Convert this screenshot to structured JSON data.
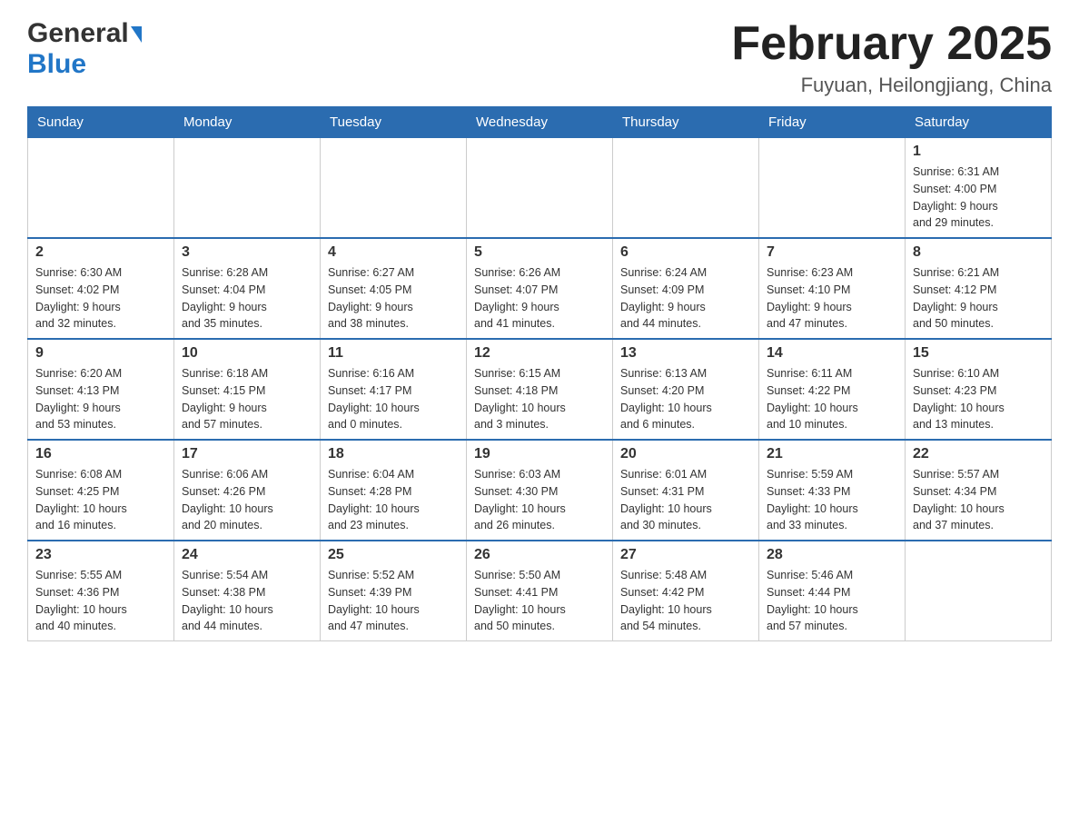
{
  "header": {
    "logo_general": "General",
    "logo_blue": "Blue",
    "month_title": "February 2025",
    "location": "Fuyuan, Heilongjiang, China"
  },
  "weekdays": [
    "Sunday",
    "Monday",
    "Tuesday",
    "Wednesday",
    "Thursday",
    "Friday",
    "Saturday"
  ],
  "weeks": [
    [
      {
        "day": "",
        "info": ""
      },
      {
        "day": "",
        "info": ""
      },
      {
        "day": "",
        "info": ""
      },
      {
        "day": "",
        "info": ""
      },
      {
        "day": "",
        "info": ""
      },
      {
        "day": "",
        "info": ""
      },
      {
        "day": "1",
        "info": "Sunrise: 6:31 AM\nSunset: 4:00 PM\nDaylight: 9 hours\nand 29 minutes."
      }
    ],
    [
      {
        "day": "2",
        "info": "Sunrise: 6:30 AM\nSunset: 4:02 PM\nDaylight: 9 hours\nand 32 minutes."
      },
      {
        "day": "3",
        "info": "Sunrise: 6:28 AM\nSunset: 4:04 PM\nDaylight: 9 hours\nand 35 minutes."
      },
      {
        "day": "4",
        "info": "Sunrise: 6:27 AM\nSunset: 4:05 PM\nDaylight: 9 hours\nand 38 minutes."
      },
      {
        "day": "5",
        "info": "Sunrise: 6:26 AM\nSunset: 4:07 PM\nDaylight: 9 hours\nand 41 minutes."
      },
      {
        "day": "6",
        "info": "Sunrise: 6:24 AM\nSunset: 4:09 PM\nDaylight: 9 hours\nand 44 minutes."
      },
      {
        "day": "7",
        "info": "Sunrise: 6:23 AM\nSunset: 4:10 PM\nDaylight: 9 hours\nand 47 minutes."
      },
      {
        "day": "8",
        "info": "Sunrise: 6:21 AM\nSunset: 4:12 PM\nDaylight: 9 hours\nand 50 minutes."
      }
    ],
    [
      {
        "day": "9",
        "info": "Sunrise: 6:20 AM\nSunset: 4:13 PM\nDaylight: 9 hours\nand 53 minutes."
      },
      {
        "day": "10",
        "info": "Sunrise: 6:18 AM\nSunset: 4:15 PM\nDaylight: 9 hours\nand 57 minutes."
      },
      {
        "day": "11",
        "info": "Sunrise: 6:16 AM\nSunset: 4:17 PM\nDaylight: 10 hours\nand 0 minutes."
      },
      {
        "day": "12",
        "info": "Sunrise: 6:15 AM\nSunset: 4:18 PM\nDaylight: 10 hours\nand 3 minutes."
      },
      {
        "day": "13",
        "info": "Sunrise: 6:13 AM\nSunset: 4:20 PM\nDaylight: 10 hours\nand 6 minutes."
      },
      {
        "day": "14",
        "info": "Sunrise: 6:11 AM\nSunset: 4:22 PM\nDaylight: 10 hours\nand 10 minutes."
      },
      {
        "day": "15",
        "info": "Sunrise: 6:10 AM\nSunset: 4:23 PM\nDaylight: 10 hours\nand 13 minutes."
      }
    ],
    [
      {
        "day": "16",
        "info": "Sunrise: 6:08 AM\nSunset: 4:25 PM\nDaylight: 10 hours\nand 16 minutes."
      },
      {
        "day": "17",
        "info": "Sunrise: 6:06 AM\nSunset: 4:26 PM\nDaylight: 10 hours\nand 20 minutes."
      },
      {
        "day": "18",
        "info": "Sunrise: 6:04 AM\nSunset: 4:28 PM\nDaylight: 10 hours\nand 23 minutes."
      },
      {
        "day": "19",
        "info": "Sunrise: 6:03 AM\nSunset: 4:30 PM\nDaylight: 10 hours\nand 26 minutes."
      },
      {
        "day": "20",
        "info": "Sunrise: 6:01 AM\nSunset: 4:31 PM\nDaylight: 10 hours\nand 30 minutes."
      },
      {
        "day": "21",
        "info": "Sunrise: 5:59 AM\nSunset: 4:33 PM\nDaylight: 10 hours\nand 33 minutes."
      },
      {
        "day": "22",
        "info": "Sunrise: 5:57 AM\nSunset: 4:34 PM\nDaylight: 10 hours\nand 37 minutes."
      }
    ],
    [
      {
        "day": "23",
        "info": "Sunrise: 5:55 AM\nSunset: 4:36 PM\nDaylight: 10 hours\nand 40 minutes."
      },
      {
        "day": "24",
        "info": "Sunrise: 5:54 AM\nSunset: 4:38 PM\nDaylight: 10 hours\nand 44 minutes."
      },
      {
        "day": "25",
        "info": "Sunrise: 5:52 AM\nSunset: 4:39 PM\nDaylight: 10 hours\nand 47 minutes."
      },
      {
        "day": "26",
        "info": "Sunrise: 5:50 AM\nSunset: 4:41 PM\nDaylight: 10 hours\nand 50 minutes."
      },
      {
        "day": "27",
        "info": "Sunrise: 5:48 AM\nSunset: 4:42 PM\nDaylight: 10 hours\nand 54 minutes."
      },
      {
        "day": "28",
        "info": "Sunrise: 5:46 AM\nSunset: 4:44 PM\nDaylight: 10 hours\nand 57 minutes."
      },
      {
        "day": "",
        "info": ""
      }
    ]
  ]
}
